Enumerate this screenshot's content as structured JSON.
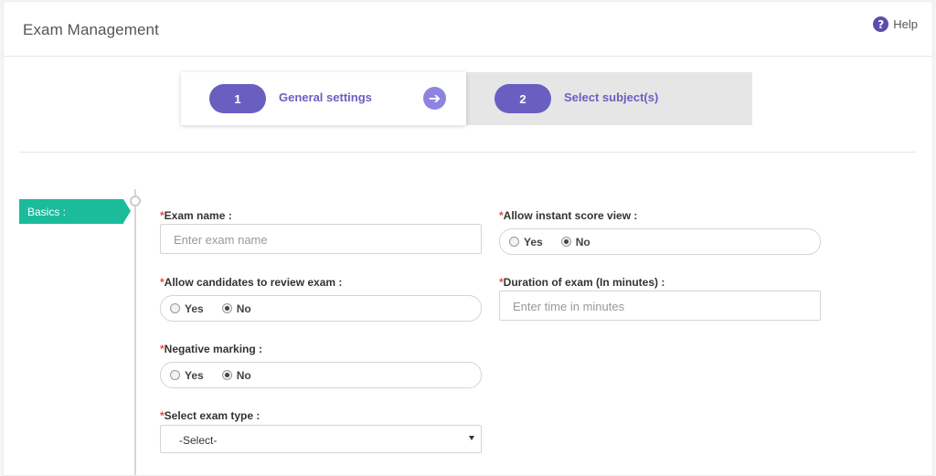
{
  "header": {
    "title": "Exam Management",
    "help_label": "Help",
    "help_icon": "question-circle-icon"
  },
  "wizard": {
    "steps": [
      {
        "number": "1",
        "label": "General settings",
        "active": true
      },
      {
        "number": "2",
        "label": "Select subject(s)",
        "active": false
      }
    ],
    "next_icon": "arrow-right-circle-icon",
    "accent_color": "#6a5fc1"
  },
  "section": {
    "label": "Basics :",
    "color": "#1abc9c"
  },
  "form": {
    "required_mark": "*",
    "exam_name": {
      "label": "Exam name :",
      "placeholder": "Enter exam name"
    },
    "instant_score": {
      "label": "Allow instant score view :",
      "options": [
        "Yes",
        "No"
      ],
      "selected": "No"
    },
    "review_exam": {
      "label": "Allow candidates to review exam :",
      "options": [
        "Yes",
        "No"
      ],
      "selected": "No"
    },
    "duration": {
      "label": "Duration of exam (In minutes) :",
      "placeholder": "Enter time in minutes"
    },
    "negative_marking": {
      "label": "Negative marking :",
      "options": [
        "Yes",
        "No"
      ],
      "selected": "No"
    },
    "exam_type": {
      "label": "Select exam type :",
      "value": "-Select-"
    }
  }
}
